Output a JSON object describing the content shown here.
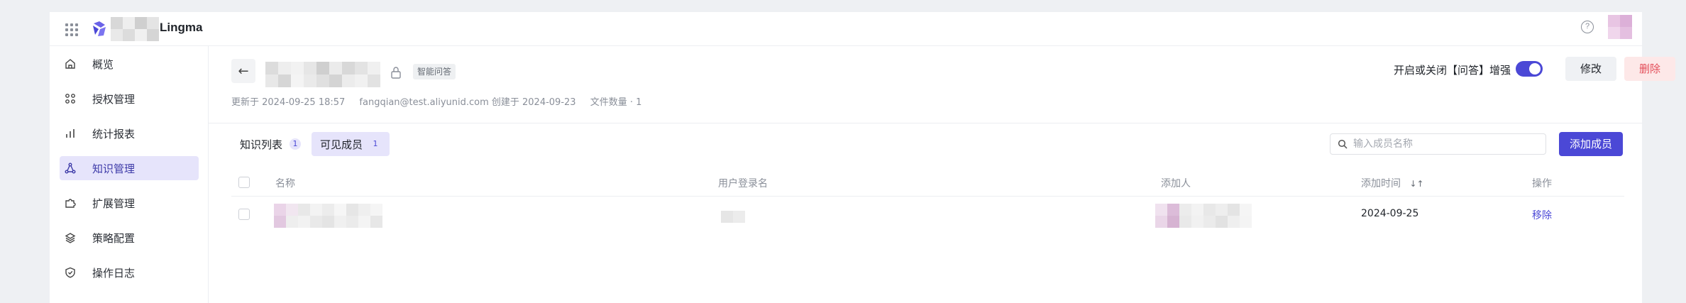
{
  "app": {
    "brand_name": "Lingma",
    "brand_color": "#4b48d6"
  },
  "header": {
    "help_icon_glyph": "?"
  },
  "sidebar": {
    "items": [
      {
        "label": "概览",
        "icon": "home-icon",
        "active": false
      },
      {
        "label": "授权管理",
        "icon": "grid-icon",
        "active": false
      },
      {
        "label": "统计报表",
        "icon": "bar-chart-icon",
        "active": false
      },
      {
        "label": "知识管理",
        "icon": "knowledge-icon",
        "active": true
      },
      {
        "label": "扩展管理",
        "icon": "puzzle-icon",
        "active": false
      },
      {
        "label": "策略配置",
        "icon": "layers-icon",
        "active": false
      },
      {
        "label": "操作日志",
        "icon": "shield-icon",
        "active": false
      }
    ]
  },
  "detail": {
    "back_glyph": "←",
    "tag": "智能问答",
    "meta": {
      "updated": "更新于 2024-09-25 18:57",
      "creator": "fangqian@test.aliyunid.com 创建于 2024-09-23",
      "file_count": "文件数量 · 1"
    },
    "toggle_label": "开启或关闭【问答】增强",
    "toggle_on": true,
    "edit_label": "修改",
    "delete_label": "删除"
  },
  "tabs": [
    {
      "label": "知识列表",
      "count": "1",
      "active": false
    },
    {
      "label": "可见成员",
      "count": "1",
      "active": true
    }
  ],
  "search": {
    "placeholder": "输入成员名称",
    "value": ""
  },
  "add_member_label": "添加成员",
  "table": {
    "columns": [
      "名称",
      "用户登录名",
      "添加人",
      "添加时间",
      "操作"
    ],
    "sort_glyph": "↓↑",
    "rows": [
      {
        "added_at": "2024-09-25",
        "action": "移除"
      }
    ]
  }
}
